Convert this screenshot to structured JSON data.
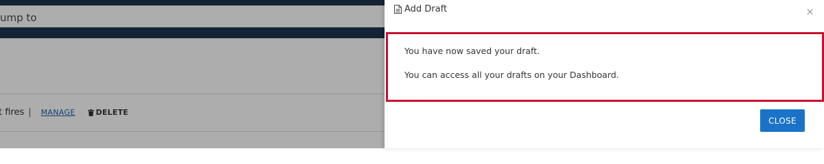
{
  "background": {
    "jump_placeholder": "Jump to",
    "jump_value": "ump to",
    "row_tail_text": "t fires",
    "row_separator": "|",
    "manage_label": "MANAGE",
    "delete_label": "DELETE"
  },
  "modal": {
    "title": "Add Draft",
    "title_icon": "document-icon",
    "close_icon": "×",
    "message_line_1": "You have now saved your draft.",
    "message_line_2": "You can access all your drafts on your Dashboard.",
    "close_button_label": "CLOSE"
  },
  "colors": {
    "navy": "#1e3550",
    "highlight_border": "#c8102e",
    "primary_button": "#1a73c8",
    "link": "#1a5fa3"
  }
}
